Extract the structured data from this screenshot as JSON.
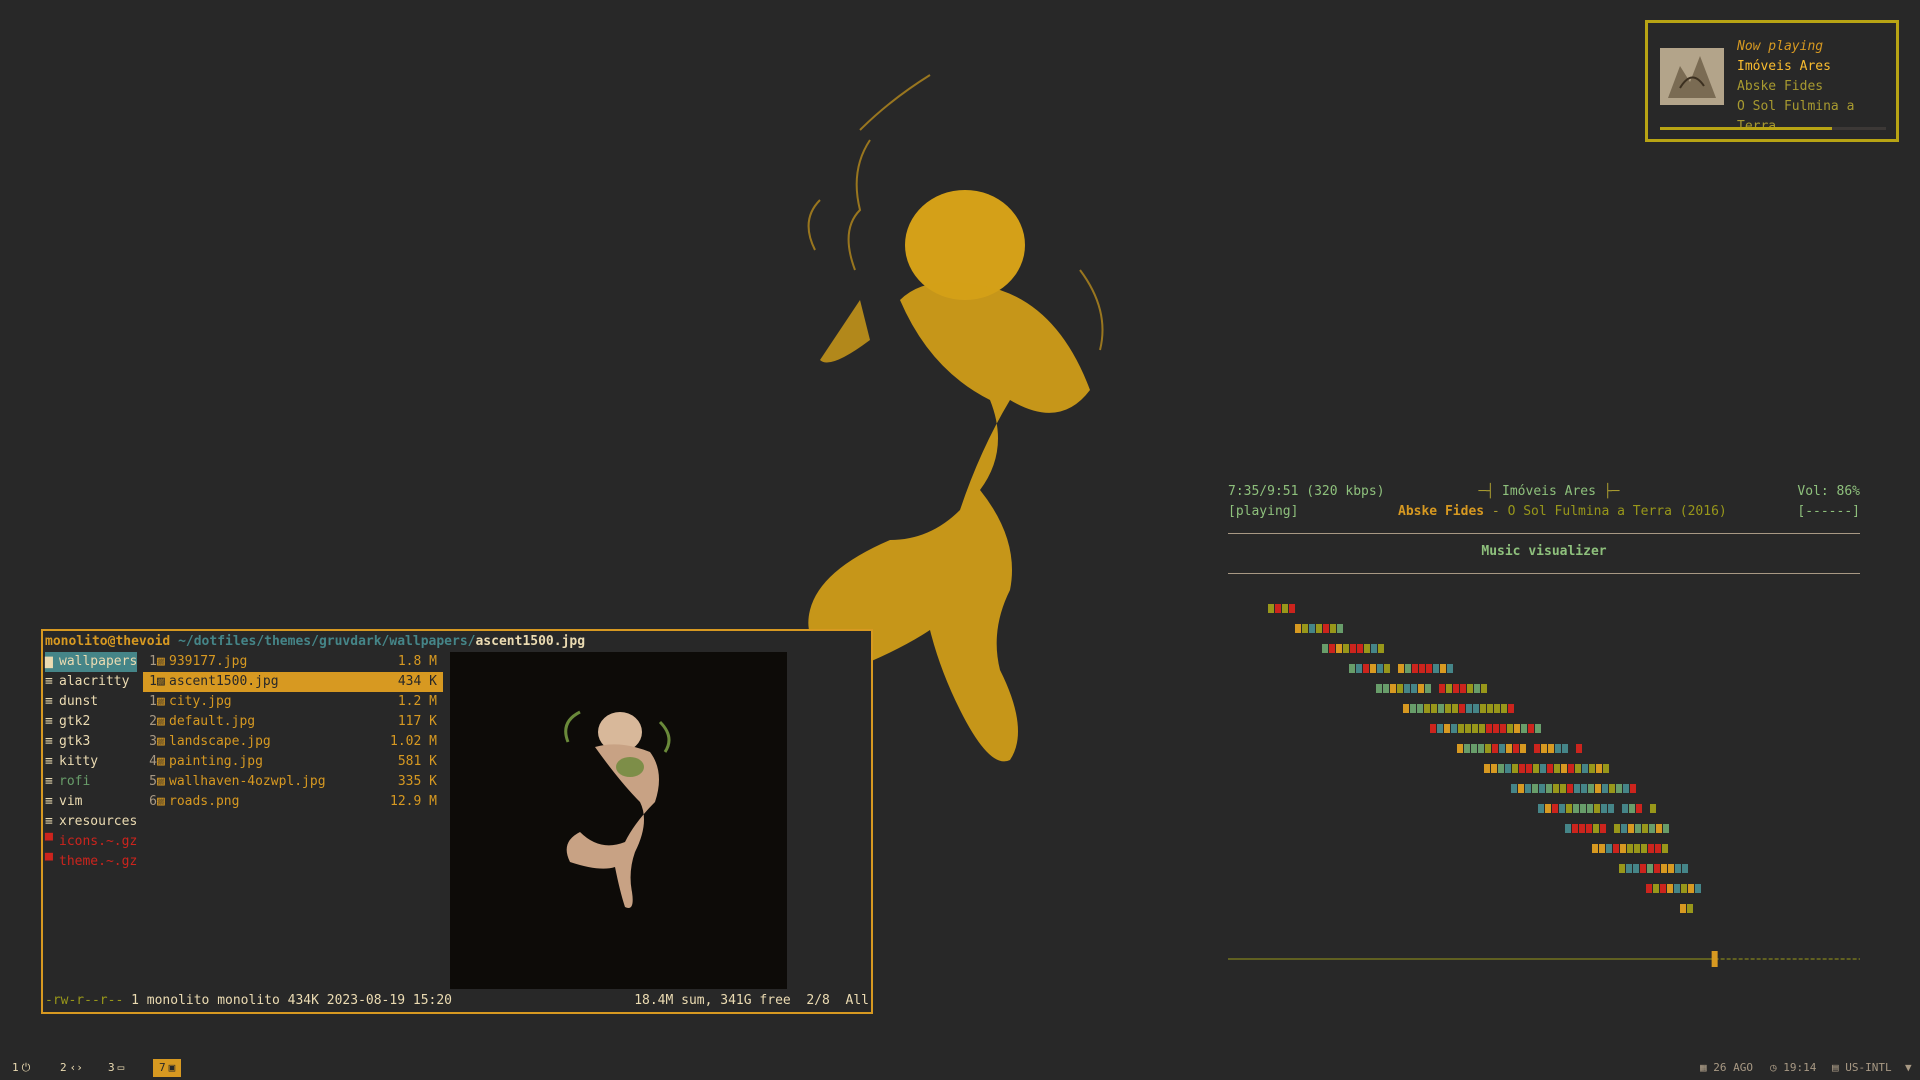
{
  "now_playing": {
    "header": "Now playing",
    "title": "Imóveis Ares",
    "artist": "Abske Fides",
    "album": "O Sol Fulmina a Terra",
    "progress": 0.76
  },
  "ncmpcpp": {
    "time": "7:35/9:51 (320 kbps)",
    "state": "[playing]",
    "title_deco_left": "─┤",
    "title": "Imóveis Ares",
    "title_deco_right": "├─",
    "artist": "Abske Fides",
    "separator": " - ",
    "album": "O Sol Fulmina a Terra (2016)",
    "volume": "Vol: 86%",
    "flags": "[------]",
    "section_title": "Music visualizer",
    "seek_progress": 0.77
  },
  "terminal": {
    "user_host": "monolito@thevoid",
    "path": "~/dotfiles/themes/gruvdark/wallpapers/",
    "current_file": "ascent1500.jpg",
    "left_column": [
      {
        "label": "wallpapers",
        "icon": "folder-icon",
        "selected": true
      },
      {
        "label": "alacritty",
        "icon": "file-lines-icon"
      },
      {
        "label": "dunst",
        "icon": "file-lines-icon"
      },
      {
        "label": "gtk2",
        "icon": "file-lines-icon"
      },
      {
        "label": "gtk3",
        "icon": "file-lines-icon"
      },
      {
        "label": "kitty",
        "icon": "file-lines-icon"
      },
      {
        "label": "rofi",
        "icon": "file-lines-icon",
        "style": "teal"
      },
      {
        "label": "vim",
        "icon": "file-lines-icon"
      },
      {
        "label": "xresources",
        "icon": "file-lines-icon"
      },
      {
        "label": "icons.~.gz",
        "icon": "archive-icon",
        "style": "red"
      },
      {
        "label": "theme.~.gz",
        "icon": "archive-icon",
        "style": "red"
      }
    ],
    "files": [
      {
        "count": "1",
        "name": "939177.jpg",
        "size": "1.8 M"
      },
      {
        "count": "1",
        "name": "ascent1500.jpg",
        "size": "434 K",
        "selected": true
      },
      {
        "count": "1",
        "name": "city.jpg",
        "size": "1.2 M"
      },
      {
        "count": "2",
        "name": "default.jpg",
        "size": "117 K"
      },
      {
        "count": "3",
        "name": "landscape.jpg",
        "size": "1.02 M"
      },
      {
        "count": "4",
        "name": "painting.jpg",
        "size": "581 K"
      },
      {
        "count": "5",
        "name": "wallhaven-4ozwpl.jpg",
        "size": "335 K"
      },
      {
        "count": "6",
        "name": "roads.png",
        "size": "12.9 M"
      }
    ],
    "status_perm": "-rw-r--r--",
    "status_info": " 1 monolito monolito 434K 2023-08-19 15:20",
    "status_right": "18.4M sum, 341G free  2/8  All"
  },
  "bar": {
    "workspaces": [
      {
        "num": "1",
        "icon": "power-icon",
        "glyph": "⏻"
      },
      {
        "num": "2",
        "icon": "code-icon",
        "glyph": "‹›"
      },
      {
        "num": "3",
        "icon": "folder-icon",
        "glyph": "▭"
      },
      {
        "num": "7",
        "icon": "terminal-icon",
        "glyph": "▣",
        "active": true
      }
    ],
    "date": "26 AGO",
    "time": "19:14",
    "keyboard": "US-INTL"
  },
  "colors": {
    "background": "#282828",
    "yellow": "#d79921",
    "green": "#98971a",
    "blue": "#458588",
    "red": "#cc241d",
    "fg": "#ebdbb2"
  }
}
